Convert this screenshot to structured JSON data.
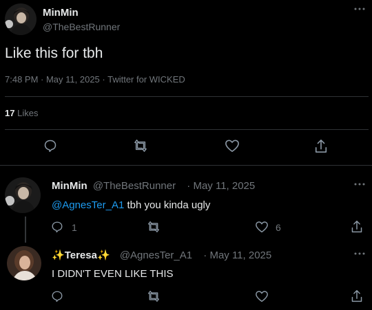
{
  "main_tweet": {
    "display_name": "MinMin",
    "handle": "@TheBestRunner",
    "text": "Like this for tbh",
    "meta": "7:48 PM · May 11, 2025 · Twitter for WICKED",
    "likes_count": "17",
    "likes_label": "Likes"
  },
  "reply1": {
    "display_name": "MinMin",
    "handle": "@TheBestRunner",
    "date": "· May 11, 2025",
    "mention": "@AgnesTer_A1",
    "text": " tbh you kinda ugly",
    "reply_count": "1",
    "like_count": "6"
  },
  "reply2": {
    "display_name": "Teresa",
    "handle": "@AgnesTer_A1",
    "date": "· May 11, 2025",
    "text": "I DIDN'T EVEN LIKE THIS"
  },
  "colors": {
    "accent": "#1d9bf0",
    "secondary": "#71767b",
    "background": "#000000"
  }
}
